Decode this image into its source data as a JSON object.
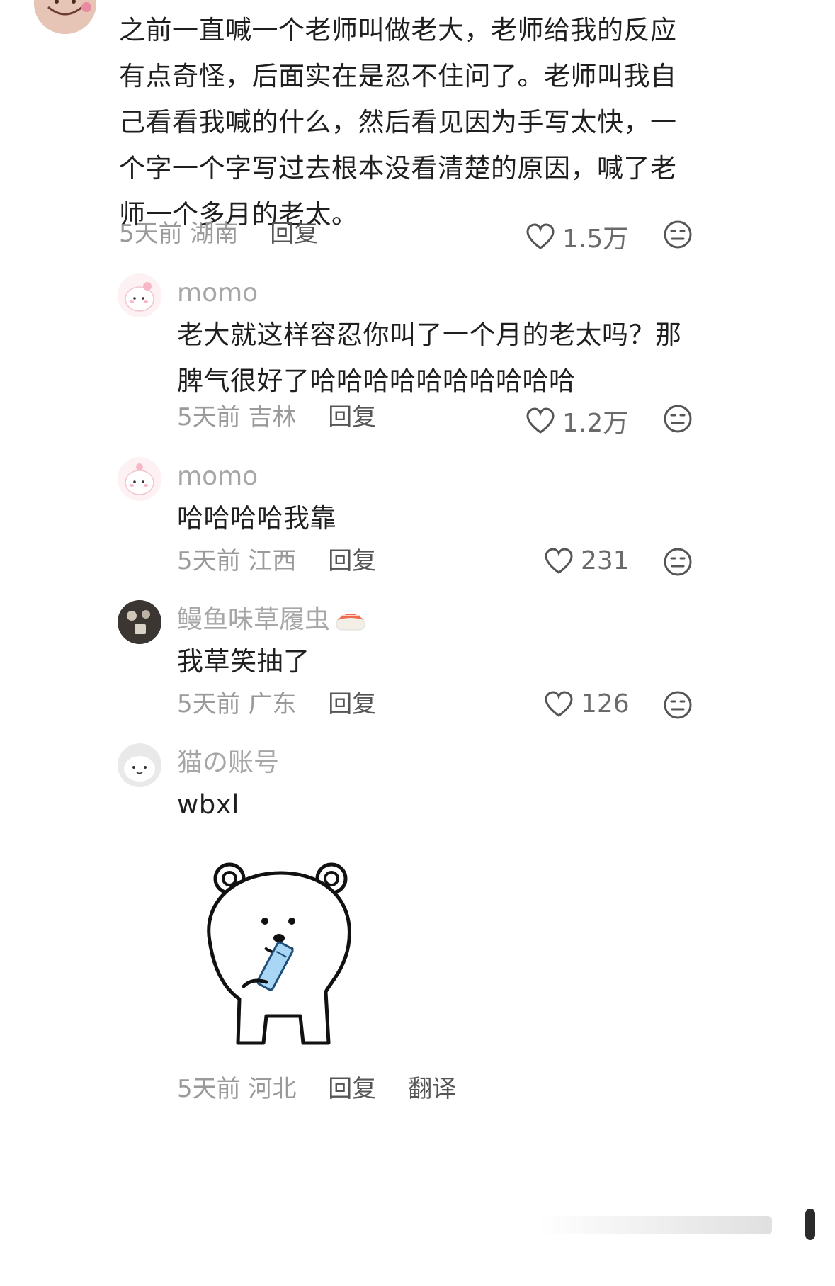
{
  "comments": [
    {
      "text": "之前一直喊一个老师叫做老大，老师给我的反应有点奇怪，后面实在是忍不住问了。老师叫我自己看看我喊的什么，然后看见因为手写太快，一个字一个字写过去根本没看清楚的原因，喊了老师一个多月的老太。",
      "time": "5天前",
      "location": "湖南",
      "reply": "回复",
      "likes": "1.5万"
    },
    {
      "username": "momo",
      "text": "老大就这样容忍你叫了一个月的老太吗？那脾气很好了哈哈哈哈哈哈哈哈哈哈",
      "time": "5天前",
      "location": "吉林",
      "reply": "回复",
      "likes": "1.2万"
    },
    {
      "username": "momo",
      "text": "哈哈哈哈我靠",
      "time": "5天前",
      "location": "江西",
      "reply": "回复",
      "likes": "231"
    },
    {
      "username": "鳗鱼味草履虫",
      "text": "我草笑抽了",
      "time": "5天前",
      "location": "广东",
      "reply": "回复",
      "likes": "126"
    },
    {
      "username": "猫の账号",
      "text": "wbxl",
      "time": "5天前",
      "location": "河北",
      "reply": "回复",
      "translate": "翻译"
    }
  ],
  "icons": {
    "like": "heart-outline-icon",
    "reaction": "neutral-face-icon",
    "sticker": "white-bear-drinking-sticker",
    "username_emoji": "sushi-emoji"
  },
  "colors": {
    "text": "#1f1f1f",
    "muted": "#9a9a9a",
    "username": "#a7a7a7"
  }
}
